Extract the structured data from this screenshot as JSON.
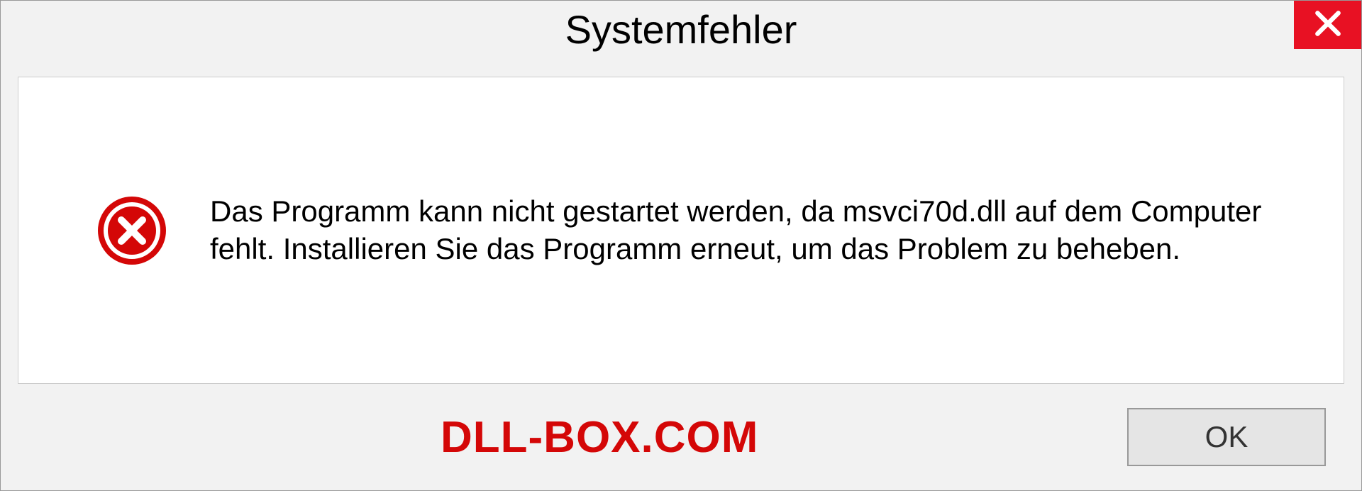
{
  "titlebar": {
    "title": "Systemfehler"
  },
  "message": {
    "text": "Das Programm kann nicht gestartet werden, da msvci70d.dll auf dem Computer fehlt. Installieren Sie das Programm erneut, um das Problem zu beheben."
  },
  "footer": {
    "watermark": "DLL-BOX.COM",
    "ok_label": "OK"
  },
  "colors": {
    "error_red": "#d40707",
    "close_red": "#e81123"
  }
}
